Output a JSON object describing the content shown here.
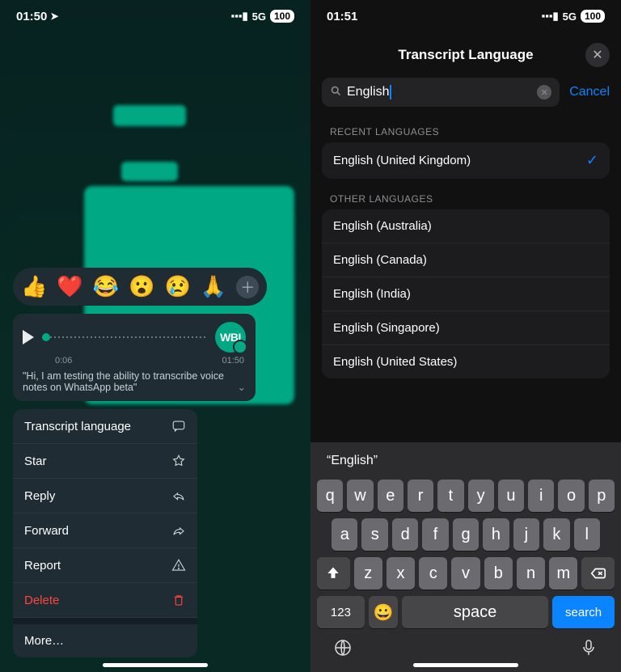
{
  "left": {
    "status": {
      "time": "01:50",
      "network": "5G",
      "battery": "100"
    },
    "reactions": [
      "👍",
      "❤️",
      "😂",
      "😮",
      "😢",
      "🙏"
    ],
    "voice": {
      "avatar": "WBI",
      "elapsed": "0:06",
      "total": "01:50",
      "transcript": "\"Hi, I am testing the ability to transcribe voice notes on WhatsApp beta\""
    },
    "menu": {
      "transcript_lang": "Transcript language",
      "star": "Star",
      "reply": "Reply",
      "forward": "Forward",
      "report": "Report",
      "delete": "Delete",
      "more": "More…"
    }
  },
  "right": {
    "status": {
      "time": "01:51",
      "network": "5G",
      "battery": "100"
    },
    "title": "Transcript Language",
    "search": {
      "value": "English",
      "cancel": "Cancel"
    },
    "sections": {
      "recent_header": "Recent languages",
      "recent": [
        "English (United Kingdom)"
      ],
      "other_header": "Other languages",
      "other": [
        "English (Australia)",
        "English (Canada)",
        "English (India)",
        "English (Singapore)",
        "English (United States)"
      ]
    },
    "suggestion": "“English”",
    "keys": {
      "row1": [
        "q",
        "w",
        "e",
        "r",
        "t",
        "y",
        "u",
        "i",
        "o",
        "p"
      ],
      "row2": [
        "a",
        "s",
        "d",
        "f",
        "g",
        "h",
        "j",
        "k",
        "l"
      ],
      "row3": [
        "z",
        "x",
        "c",
        "v",
        "b",
        "n",
        "m"
      ],
      "num": "123",
      "space": "space",
      "search": "search"
    }
  }
}
